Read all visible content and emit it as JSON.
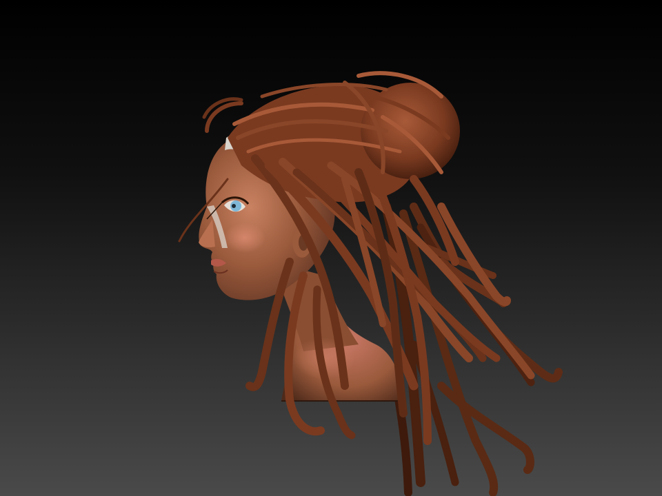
{
  "scene": {
    "subject_icon": "sculpted-bust-figure",
    "colors": {
      "background_top": "#000000",
      "background_bottom": "#4a4a4a",
      "skin_base": "#9a5a3c",
      "skin_shadow": "#5a3020",
      "skin_highlight": "#c98262",
      "cheek_blush": "#c97a66",
      "hair_base": "#7a3a20",
      "hair_shadow": "#3e1a0c",
      "hair_highlight": "#a85a38",
      "eye_iris": "#7fb7d6",
      "eye_white": "#e7e0d8",
      "headband": "#d9d4cc",
      "lips": "#b4584a"
    }
  }
}
